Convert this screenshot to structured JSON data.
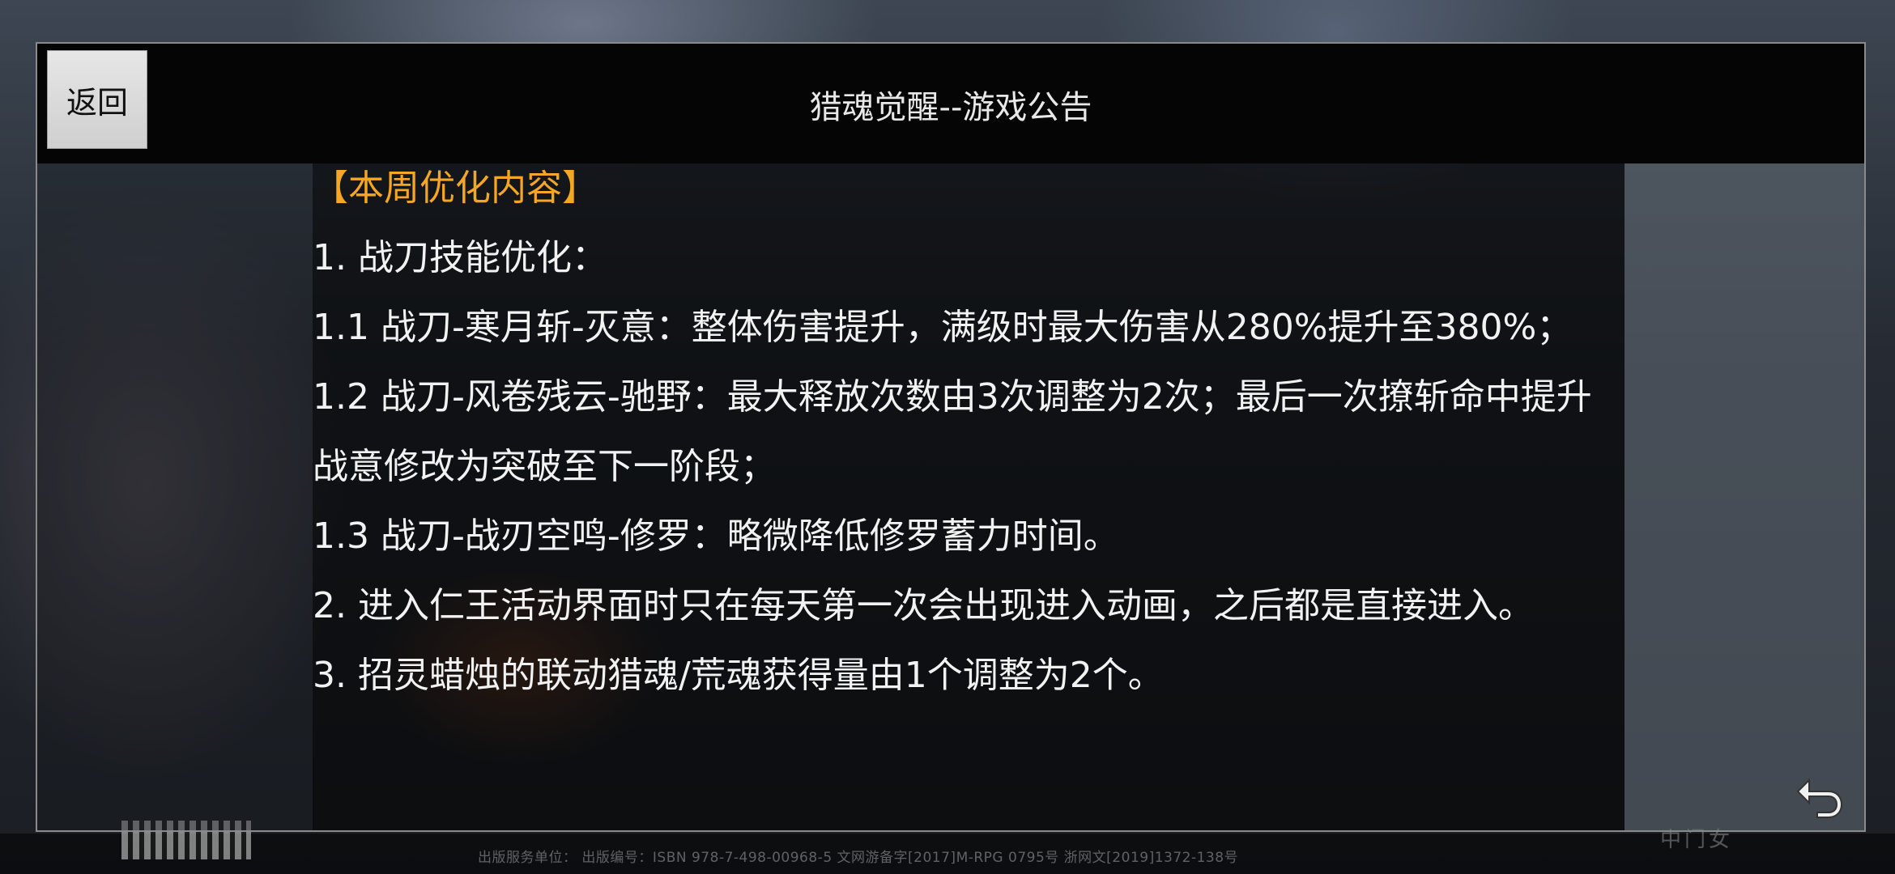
{
  "window": {
    "back_label": "返回",
    "title": "猎魂觉醒--游戏公告"
  },
  "announcement": {
    "heading": "【本周优化内容】",
    "lines": [
      "1. 战刀技能优化：",
      "1.1 战刀-寒月斩-灭意：整体伤害提升，满级时最大伤害从280%提升至380%；",
      "1.2 战刀-风卷残云-驰野：最大释放次数由3次调整为2次；最后一次撩斩命中提升战意修改为突破至下一阶段；",
      "1.3 战刀-战刃空鸣-修罗：略微降低修罗蓄力时间。",
      "2. 进入仁王活动界面时只在每天第一次会出现进入动画，之后都是直接进入。",
      "3. 招灵蜡烛的联动猎魂/荒魂获得量由1个调整为2个。"
    ]
  },
  "footer": {
    "text": "出版服务单位：  出版编号：ISBN 978-7-498-00968-5   文网游备字[2017]M-RPG 0795号   浙网文[2019]1372-138号"
  },
  "icons": {
    "back_floating": "return-arrow-icon"
  },
  "colors": {
    "heading": "#f5a623",
    "body_text": "#f2f2f2",
    "titlebar": "#050505"
  }
}
